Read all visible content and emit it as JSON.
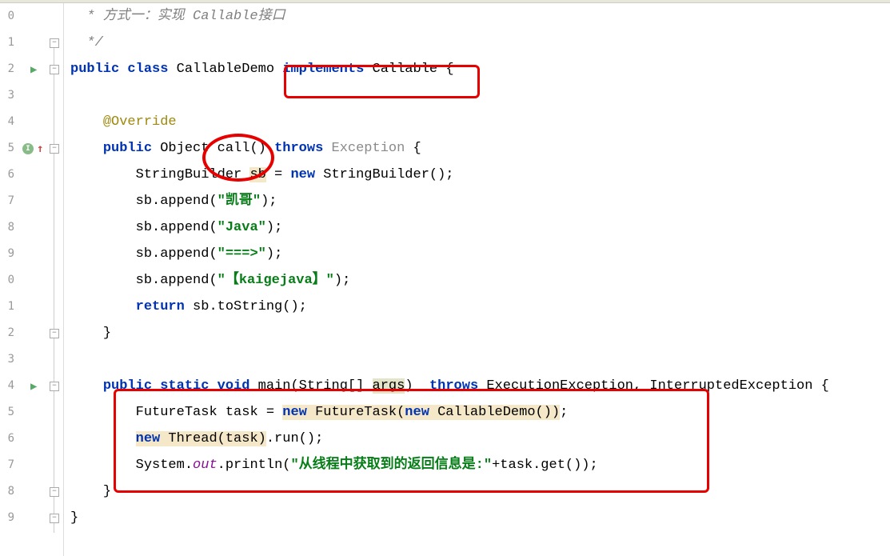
{
  "lineNumbers": [
    "0",
    "1",
    "2",
    "3",
    "4",
    "5",
    "6",
    "7",
    "8",
    "9",
    "0",
    "1",
    "2",
    "3",
    "4",
    "5",
    "6",
    "7",
    "8",
    "9"
  ],
  "code": {
    "l10": {
      "comment": " * 方式一：实现 Callable接口"
    },
    "l11": {
      "comment": " */"
    },
    "l12": {
      "kw1": "public",
      "kw2": "class",
      "cls": "CallableDemo",
      "kw3": "implements",
      "iface": "Callable",
      "brace": "{"
    },
    "l14": {
      "ann": "@Override"
    },
    "l15": {
      "kw1": "public",
      "ret": "Object",
      "method": "call",
      "parens": "()",
      "kw2": "throws",
      "ex": "Exception",
      "brace": "{"
    },
    "l16": {
      "t1": "StringBuilder ",
      "v": "sb",
      "t2": " = ",
      "kw": "new",
      "t3": " StringBuilder();"
    },
    "l17": {
      "pre": "sb.append(",
      "str": "\"凯哥\"",
      "post": ");"
    },
    "l18": {
      "pre": "sb.append(",
      "str": "\"Java\"",
      "post": ");"
    },
    "l19": {
      "pre": "sb.append(",
      "str": "\"===>\"",
      "post": ");"
    },
    "l20": {
      "pre": "sb.append(",
      "str": "\"【kaigejava】\"",
      "post": ");"
    },
    "l21": {
      "kw": "return",
      "rest": " sb.toString();"
    },
    "l22": {
      "brace": "}"
    },
    "l24": {
      "kw1": "public",
      "kw2": "static",
      "kw3": "void",
      "method": "main",
      "p1": "(String[] ",
      "arg": "args",
      "p2": ")  ",
      "kw4": "throws",
      "ex": " ExecutionException, InterruptedException {"
    },
    "l25": {
      "pre": "FutureTask task = ",
      "kw1": "new",
      "mid1": " FutureTask(",
      "kw2": "new",
      "mid2": " CallableDemo())",
      "post": ";"
    },
    "l26": {
      "kw1": "new",
      "mid": " Thread(task)",
      "post": ".run();"
    },
    "l27": {
      "pre": "System.",
      "out": "out",
      "mid": ".println(",
      "str": "\"从线程中获取到的返回信息是:\"",
      "post": "+task.get());"
    },
    "l28": {
      "brace": "}"
    },
    "l29": {
      "brace": "}"
    }
  }
}
